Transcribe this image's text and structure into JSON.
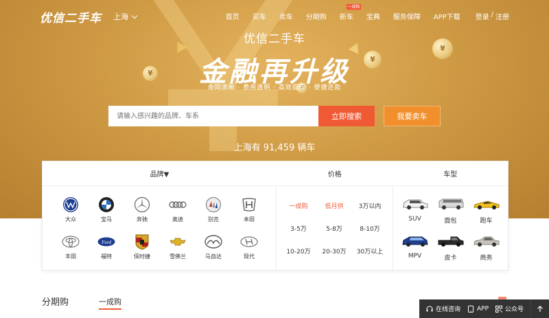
{
  "header": {
    "logo": "优信二手车",
    "city": "上海",
    "nav": [
      {
        "label": "首页",
        "badge": ""
      },
      {
        "label": "买车",
        "badge": ""
      },
      {
        "label": "卖车",
        "badge": ""
      },
      {
        "label": "分期购",
        "badge": ""
      },
      {
        "label": "新车",
        "badge": "一成购"
      },
      {
        "label": "宝典",
        "badge": ""
      },
      {
        "label": "服务保障",
        "badge": ""
      },
      {
        "label": "APP下载",
        "badge": ""
      }
    ],
    "login": "登录",
    "register": "注册",
    "login_sep": "/"
  },
  "hero": {
    "subtitle": "优信二手车",
    "title": "金融再升级",
    "tags": "合同清晰 · 费用透明 · 高效提车 · 便捷还款"
  },
  "search": {
    "placeholder": "请输入感兴趣的品牌、车系",
    "button": "立即搜索",
    "sell_button": "我要卖车"
  },
  "inventory": "上海有 91,459 辆车",
  "filters": {
    "brand_header": "品牌▼",
    "price_header": "价格",
    "type_header": "车型",
    "brands": [
      {
        "name": "大众",
        "icon": "vw-logo"
      },
      {
        "name": "宝马",
        "icon": "bmw-logo"
      },
      {
        "name": "奔驰",
        "icon": "benz-logo"
      },
      {
        "name": "奥迪",
        "icon": "audi-logo"
      },
      {
        "name": "别克",
        "icon": "buick-logo"
      },
      {
        "name": "本田",
        "icon": "honda-logo"
      },
      {
        "name": "丰田",
        "icon": "toyota-logo"
      },
      {
        "name": "福特",
        "icon": "ford-logo"
      },
      {
        "name": "保时捷",
        "icon": "porsche-logo"
      },
      {
        "name": "雪佛兰",
        "icon": "chevrolet-logo"
      },
      {
        "name": "马自达",
        "icon": "mazda-logo"
      },
      {
        "name": "现代",
        "icon": "hyundai-logo"
      }
    ],
    "prices": [
      {
        "label": "一成购",
        "hot": true
      },
      {
        "label": "低月供",
        "hot": true
      },
      {
        "label": "3万以内",
        "hot": false
      },
      {
        "label": "3-5万",
        "hot": false
      },
      {
        "label": "5-8万",
        "hot": false
      },
      {
        "label": "8-10万",
        "hot": false
      },
      {
        "label": "10-20万",
        "hot": false
      },
      {
        "label": "20-30万",
        "hot": false
      },
      {
        "label": "30万以上",
        "hot": false
      }
    ],
    "types": [
      {
        "label": "SUV",
        "color": "#ffffff"
      },
      {
        "label": "面包",
        "color": "#d8d8d8"
      },
      {
        "label": "跑车",
        "color": "#f2c21a"
      },
      {
        "label": "MPV",
        "color": "#1f3f8f"
      },
      {
        "label": "皮卡",
        "color": "#2a2a2a"
      },
      {
        "label": "商务",
        "color": "#c9c3bb"
      }
    ]
  },
  "bottom": {
    "tab_main": "分期购",
    "tab_sub": "一成购"
  },
  "float_bar": {
    "consult": "在线咨询",
    "app": "APP",
    "wechat": "公众号"
  },
  "colors": {
    "accent": "#ef5a35",
    "sell": "#f08f2c",
    "hero": "#cf9a44"
  }
}
